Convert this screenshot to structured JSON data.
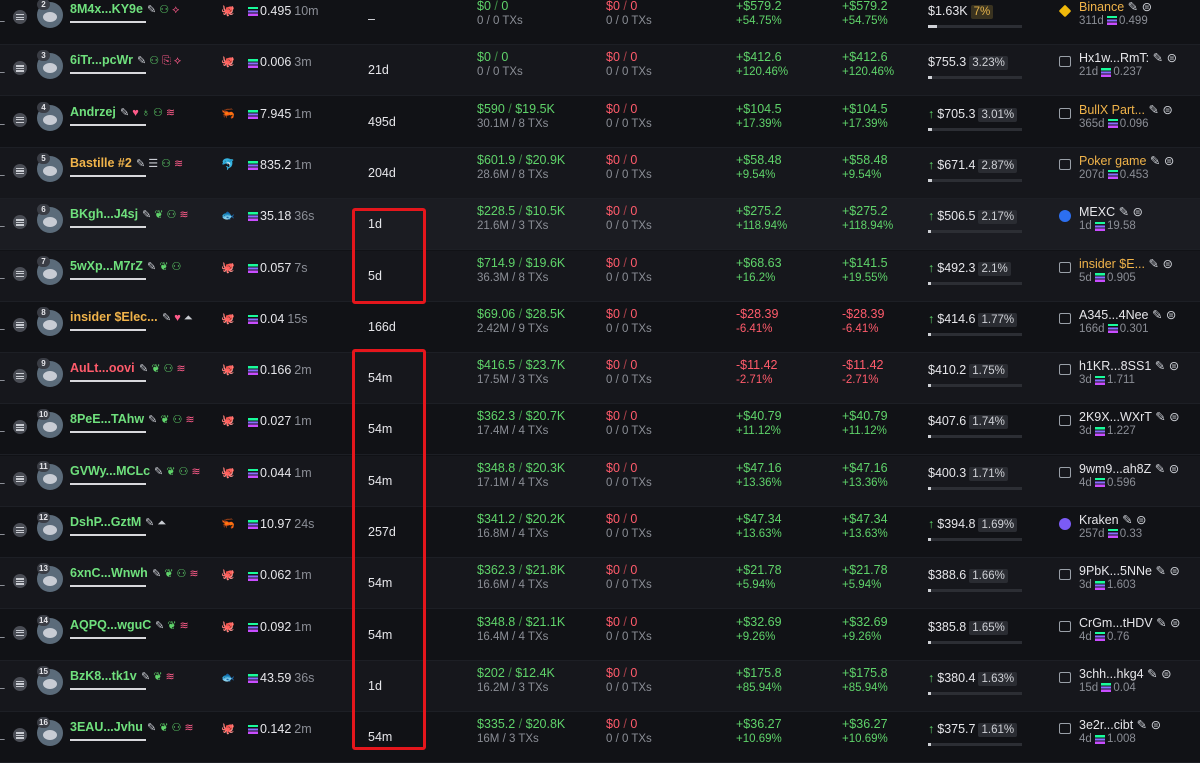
{
  "colors": {
    "accent_green": "#5fd36a",
    "accent_red": "#ff5b6b",
    "gold": "#f0b34a",
    "highlight_box": "#e5161c"
  },
  "icons": {
    "filter": "filter-icon",
    "menu": "menu-icon",
    "edit": "pencil-icon",
    "copy": "copy-icon",
    "solana": "solana-icon"
  },
  "rows": [
    {
      "rank": "2",
      "name": "8M4x...KY9e",
      "name_color": "green",
      "badges": [
        "✎",
        "⚇",
        "⟡"
      ],
      "bal_icon": "🐙",
      "balance": "0.495",
      "bal_time": "10m",
      "age": "–",
      "bought_usd": "$0",
      "bought_total": "0",
      "bought_sub": "0 / 0 TXs",
      "sold_usd": "$0",
      "sold_total": "0",
      "sold_sub": "0 / 0 TXs",
      "pnl_usd": "+$579.2",
      "pnl_pct": "+54.75%",
      "pnl2_usd": "+$579.2",
      "pnl2_pct": "+54.75%",
      "pnl_sign": "pos",
      "mc": "$1.63K",
      "mc_pct": "7%",
      "mc_fill": 0.07,
      "mc_arrow": false,
      "mc_warn": true,
      "src_icon": "binance",
      "src_name": "Binance",
      "src_gold": true,
      "src_age": "311d",
      "src_sol": "0.499"
    },
    {
      "rank": "3",
      "name": "6iTr...pcWr",
      "name_color": "green",
      "badges": [
        "✎",
        "⚇",
        "⎘",
        "⟡"
      ],
      "bal_icon": "🐙",
      "balance": "0.006",
      "bal_time": "3m",
      "age": "21d",
      "bought_usd": "$0",
      "bought_total": "0",
      "bought_sub": "0 / 0 TXs",
      "sold_usd": "$0",
      "sold_total": "0",
      "sold_sub": "0 / 0 TXs",
      "pnl_usd": "+$412.6",
      "pnl_pct": "+120.46%",
      "pnl2_usd": "+$412.6",
      "pnl2_pct": "+120.46%",
      "pnl_sign": "pos",
      "mc": "$755.3",
      "mc_pct": "3.23%",
      "mc_fill": 0.0323,
      "mc_arrow": false,
      "mc_warn": false,
      "src_icon": "box",
      "src_name": "Hx1w...RmT:",
      "src_gold": false,
      "src_age": "21d",
      "src_sol": "0.237"
    },
    {
      "rank": "4",
      "name": "Andrzej",
      "name_color": "green",
      "badges": [
        "✎",
        "",
        "♥",
        "♁",
        "⚇",
        "≋"
      ],
      "bal_icon": "🦐",
      "balance": "7.945",
      "bal_time": "1m",
      "age": "495d",
      "bought_usd": "$590",
      "bought_total": "$19.5K",
      "bought_sub": "30.1M / 8 TXs",
      "sold_usd": "$0",
      "sold_total": "0",
      "sold_sub": "0 / 0 TXs",
      "pnl_usd": "+$104.5",
      "pnl_pct": "+17.39%",
      "pnl2_usd": "+$104.5",
      "pnl2_pct": "+17.39%",
      "pnl_sign": "pos",
      "mc": "$705.3",
      "mc_pct": "3.01%",
      "mc_fill": 0.0301,
      "mc_arrow": true,
      "mc_warn": false,
      "src_icon": "box",
      "src_name": "BullX Part...",
      "src_gold": true,
      "src_age": "365d",
      "src_sol": "0.096"
    },
    {
      "rank": "5",
      "name": "Bastille #2",
      "name_color": "gold",
      "badges": [
        "✎",
        "☰",
        "⚇",
        "≋"
      ],
      "bal_icon": "🐬",
      "balance": "835.2",
      "bal_time": "1m",
      "age": "204d",
      "bought_usd": "$601.9",
      "bought_total": "$20.9K",
      "bought_sub": "28.6M / 8 TXs",
      "sold_usd": "$0",
      "sold_total": "0",
      "sold_sub": "0 / 0 TXs",
      "pnl_usd": "+$58.48",
      "pnl_pct": "+9.54%",
      "pnl2_usd": "+$58.48",
      "pnl2_pct": "+9.54%",
      "pnl_sign": "pos",
      "mc": "$671.4",
      "mc_pct": "2.87%",
      "mc_fill": 0.0287,
      "mc_arrow": true,
      "mc_warn": false,
      "src_icon": "box",
      "src_name": "Poker game",
      "src_gold": true,
      "src_age": "207d",
      "src_sol": "0.453"
    },
    {
      "rank": "6",
      "name": "BKgh...J4sj",
      "name_color": "green",
      "badges": [
        "✎",
        "❦",
        "⚇",
        "≋"
      ],
      "bal_icon": "🐟",
      "balance": "35.18",
      "bal_time": "36s",
      "age": "1d",
      "bought_usd": "$228.5",
      "bought_total": "$10.5K",
      "bought_sub": "21.6M / 3 TXs",
      "sold_usd": "$0",
      "sold_total": "0",
      "sold_sub": "0 / 0 TXs",
      "pnl_usd": "+$275.2",
      "pnl_pct": "+118.94%",
      "pnl2_usd": "+$275.2",
      "pnl2_pct": "+118.94%",
      "pnl_sign": "pos",
      "mc": "$506.5",
      "mc_pct": "2.17%",
      "mc_fill": 0.0217,
      "mc_arrow": true,
      "mc_warn": false,
      "src_icon": "mexc",
      "src_name": "MEXC",
      "src_gold": false,
      "src_age": "1d",
      "src_sol": "19.58"
    },
    {
      "rank": "7",
      "name": "5wXp...M7rZ",
      "name_color": "green",
      "badges": [
        "✎",
        "❦",
        "⚇"
      ],
      "bal_icon": "🐙",
      "balance": "0.057",
      "bal_time": "7s",
      "age": "5d",
      "bought_usd": "$714.9",
      "bought_total": "$19.6K",
      "bought_sub": "36.3M / 8 TXs",
      "sold_usd": "$0",
      "sold_total": "0",
      "sold_sub": "0 / 0 TXs",
      "pnl_usd": "+$68.63",
      "pnl_pct": "+16.2%",
      "pnl2_usd": "+$141.5",
      "pnl2_pct": "+19.55%",
      "pnl_sign": "pos",
      "mc": "$492.3",
      "mc_pct": "2.1%",
      "mc_fill": 0.021,
      "mc_arrow": true,
      "mc_warn": false,
      "src_icon": "box",
      "src_name": "insider $E...",
      "src_gold": true,
      "src_age": "5d",
      "src_sol": "0.905"
    },
    {
      "rank": "8",
      "name": "insider $Elec...",
      "name_color": "gold",
      "badges": [
        "✎",
        "♥",
        "⏶"
      ],
      "bal_icon": "🐙",
      "balance": "0.04",
      "bal_time": "15s",
      "age": "166d",
      "bought_usd": "$69.06",
      "bought_total": "$28.5K",
      "bought_sub": "2.42M / 9 TXs",
      "sold_usd": "$0",
      "sold_total": "0",
      "sold_sub": "0 / 0 TXs",
      "pnl_usd": "-$28.39",
      "pnl_pct": "-6.41%",
      "pnl2_usd": "-$28.39",
      "pnl2_pct": "-6.41%",
      "pnl_sign": "neg",
      "mc": "$414.6",
      "mc_pct": "1.77%",
      "mc_fill": 0.0177,
      "mc_arrow": true,
      "mc_warn": false,
      "src_icon": "box",
      "src_name": "A345...4Nee",
      "src_gold": false,
      "src_age": "166d",
      "src_sol": "0.301"
    },
    {
      "rank": "9",
      "name": "AuLt...oovi",
      "name_color": "pink",
      "badges": [
        "✎",
        "❦",
        "⚇",
        "≋"
      ],
      "bal_icon": "🐙",
      "balance": "0.166",
      "bal_time": "2m",
      "age": "54m",
      "bought_usd": "$416.5",
      "bought_total": "$23.7K",
      "bought_sub": "17.5M / 3 TXs",
      "sold_usd": "$0",
      "sold_total": "0",
      "sold_sub": "0 / 0 TXs",
      "pnl_usd": "-$11.42",
      "pnl_pct": "-2.71%",
      "pnl2_usd": "-$11.42",
      "pnl2_pct": "-2.71%",
      "pnl_sign": "neg",
      "mc": "$410.2",
      "mc_pct": "1.75%",
      "mc_fill": 0.0175,
      "mc_arrow": false,
      "mc_warn": false,
      "src_icon": "box",
      "src_name": "h1KR...8SS1",
      "src_gold": false,
      "src_age": "3d",
      "src_sol": "1.711"
    },
    {
      "rank": "10",
      "name": "8PeE...TAhw",
      "name_color": "green",
      "badges": [
        "✎",
        "❦",
        "⚇",
        "≋"
      ],
      "bal_icon": "🐙",
      "balance": "0.027",
      "bal_time": "1m",
      "age": "54m",
      "bought_usd": "$362.3",
      "bought_total": "$20.7K",
      "bought_sub": "17.4M / 4 TXs",
      "sold_usd": "$0",
      "sold_total": "0",
      "sold_sub": "0 / 0 TXs",
      "pnl_usd": "+$40.79",
      "pnl_pct": "+11.12%",
      "pnl2_usd": "+$40.79",
      "pnl2_pct": "+11.12%",
      "pnl_sign": "pos",
      "mc": "$407.6",
      "mc_pct": "1.74%",
      "mc_fill": 0.0174,
      "mc_arrow": false,
      "mc_warn": false,
      "src_icon": "box",
      "src_name": "2K9X...WXrT",
      "src_gold": false,
      "src_age": "3d",
      "src_sol": "1.227"
    },
    {
      "rank": "11",
      "name": "GVWy...MCLc",
      "name_color": "green",
      "badges": [
        "✎",
        "❦",
        "⚇",
        "≋"
      ],
      "bal_icon": "🐙",
      "balance": "0.044",
      "bal_time": "1m",
      "age": "54m",
      "bought_usd": "$348.8",
      "bought_total": "$20.3K",
      "bought_sub": "17.1M / 4 TXs",
      "sold_usd": "$0",
      "sold_total": "0",
      "sold_sub": "0 / 0 TXs",
      "pnl_usd": "+$47.16",
      "pnl_pct": "+13.36%",
      "pnl2_usd": "+$47.16",
      "pnl2_pct": "+13.36%",
      "pnl_sign": "pos",
      "mc": "$400.3",
      "mc_pct": "1.71%",
      "mc_fill": 0.0171,
      "mc_arrow": false,
      "mc_warn": false,
      "src_icon": "box",
      "src_name": "9wm9...ah8Z",
      "src_gold": false,
      "src_age": "4d",
      "src_sol": "0.596"
    },
    {
      "rank": "12",
      "name": "DshP...GztM",
      "name_color": "green",
      "badges": [
        "✎",
        "⏶"
      ],
      "bal_icon": "🦐",
      "balance": "10.97",
      "bal_time": "24s",
      "age": "257d",
      "bought_usd": "$341.2",
      "bought_total": "$20.2K",
      "bought_sub": "16.8M / 4 TXs",
      "sold_usd": "$0",
      "sold_total": "0",
      "sold_sub": "0 / 0 TXs",
      "pnl_usd": "+$47.34",
      "pnl_pct": "+13.63%",
      "pnl2_usd": "+$47.34",
      "pnl2_pct": "+13.63%",
      "pnl_sign": "pos",
      "mc": "$394.8",
      "mc_pct": "1.69%",
      "mc_fill": 0.0169,
      "mc_arrow": true,
      "mc_warn": false,
      "src_icon": "kraken",
      "src_name": "Kraken",
      "src_gold": false,
      "src_age": "257d",
      "src_sol": "0.33"
    },
    {
      "rank": "13",
      "name": "6xnC...Wnwh",
      "name_color": "green",
      "badges": [
        "✎",
        "❦",
        "⚇",
        "≋"
      ],
      "bal_icon": "🐙",
      "balance": "0.062",
      "bal_time": "1m",
      "age": "54m",
      "bought_usd": "$362.3",
      "bought_total": "$21.8K",
      "bought_sub": "16.6M / 4 TXs",
      "sold_usd": "$0",
      "sold_total": "0",
      "sold_sub": "0 / 0 TXs",
      "pnl_usd": "+$21.78",
      "pnl_pct": "+5.94%",
      "pnl2_usd": "+$21.78",
      "pnl2_pct": "+5.94%",
      "pnl_sign": "pos",
      "mc": "$388.6",
      "mc_pct": "1.66%",
      "mc_fill": 0.0166,
      "mc_arrow": false,
      "mc_warn": false,
      "src_icon": "box",
      "src_name": "9PbK...5NNe",
      "src_gold": false,
      "src_age": "3d",
      "src_sol": "1.603"
    },
    {
      "rank": "14",
      "name": "AQPQ...wguC",
      "name_color": "green",
      "badges": [
        "✎",
        "❦",
        "≋"
      ],
      "bal_icon": "🐙",
      "balance": "0.092",
      "bal_time": "1m",
      "age": "54m",
      "bought_usd": "$348.8",
      "bought_total": "$21.1K",
      "bought_sub": "16.4M / 4 TXs",
      "sold_usd": "$0",
      "sold_total": "0",
      "sold_sub": "0 / 0 TXs",
      "pnl_usd": "+$32.69",
      "pnl_pct": "+9.26%",
      "pnl2_usd": "+$32.69",
      "pnl2_pct": "+9.26%",
      "pnl_sign": "pos",
      "mc": "$385.8",
      "mc_pct": "1.65%",
      "mc_fill": 0.0165,
      "mc_arrow": false,
      "mc_warn": false,
      "src_icon": "box",
      "src_name": "CrGm...tHDV",
      "src_gold": false,
      "src_age": "4d",
      "src_sol": "0.76"
    },
    {
      "rank": "15",
      "name": "BzK8...tk1v",
      "name_color": "green",
      "badges": [
        "✎",
        "❦",
        "≋"
      ],
      "bal_icon": "🐟",
      "balance": "43.59",
      "bal_time": "36s",
      "age": "1d",
      "bought_usd": "$202",
      "bought_total": "$12.4K",
      "bought_sub": "16.2M / 3 TXs",
      "sold_usd": "$0",
      "sold_total": "0",
      "sold_sub": "0 / 0 TXs",
      "pnl_usd": "+$175.8",
      "pnl_pct": "+85.94%",
      "pnl2_usd": "+$175.8",
      "pnl2_pct": "+85.94%",
      "pnl_sign": "pos",
      "mc": "$380.4",
      "mc_pct": "1.63%",
      "mc_fill": 0.0163,
      "mc_arrow": true,
      "mc_warn": false,
      "src_icon": "box",
      "src_name": "3chh...hkg4",
      "src_gold": false,
      "src_age": "15d",
      "src_sol": "0.04"
    },
    {
      "rank": "16",
      "name": "3EAU...Jvhu",
      "name_color": "green",
      "badges": [
        "✎",
        "❦",
        "⚇",
        "≋"
      ],
      "bal_icon": "🐙",
      "balance": "0.142",
      "bal_time": "2m",
      "age": "54m",
      "bought_usd": "$335.2",
      "bought_total": "$20.8K",
      "bought_sub": "16M / 3 TXs",
      "sold_usd": "$0",
      "sold_total": "0",
      "sold_sub": "0 / 0 TXs",
      "pnl_usd": "+$36.27",
      "pnl_pct": "+10.69%",
      "pnl2_usd": "+$36.27",
      "pnl2_pct": "+10.69%",
      "pnl_sign": "pos",
      "mc": "$375.7",
      "mc_pct": "1.61%",
      "mc_fill": 0.0161,
      "mc_arrow": true,
      "mc_warn": false,
      "src_icon": "box",
      "src_name": "3e2r...cibt",
      "src_gold": false,
      "src_age": "4d",
      "src_sol": "1.008"
    }
  ]
}
